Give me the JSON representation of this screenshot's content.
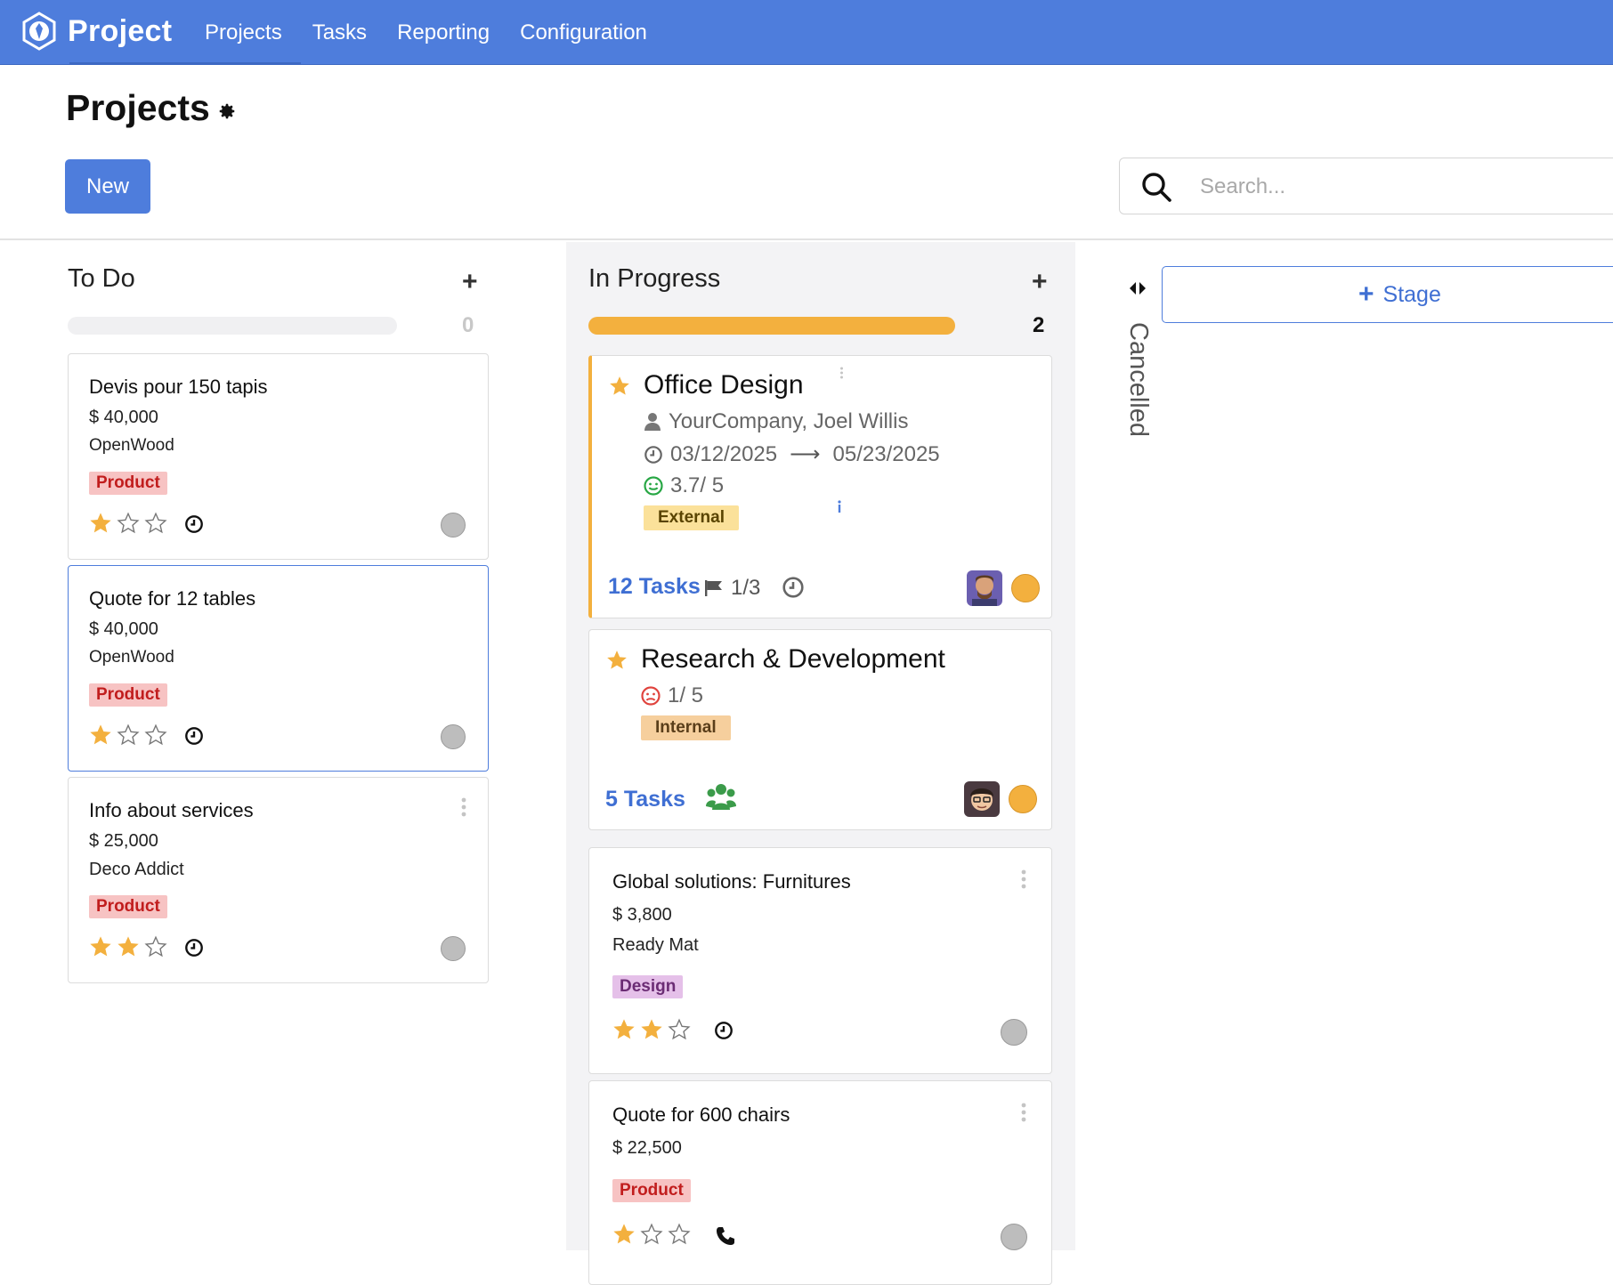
{
  "app": {
    "name": "Project",
    "nav": [
      "Projects",
      "Tasks",
      "Reporting",
      "Configuration"
    ]
  },
  "control_panel": {
    "title": "Projects",
    "new_button": "New",
    "search_placeholder": "Search..."
  },
  "columns": {
    "todo": {
      "title": "To Do",
      "count": "0",
      "progress": 0
    },
    "in_progress": {
      "title": "In Progress",
      "count": "2",
      "progress": 1.0
    },
    "cancelled": {
      "title": "Cancelled",
      "folded": true
    }
  },
  "add_stage": "Stage",
  "todo_cards": [
    {
      "title": "Devis pour 150 tapis",
      "amount": "$ 40,000",
      "partner": "OpenWood",
      "tag": "Product",
      "stars": 1
    },
    {
      "title": "Quote for 12 tables",
      "amount": "$ 40,000",
      "partner": "OpenWood",
      "tag": "Product",
      "stars": 1
    },
    {
      "title": "Info about services",
      "amount": "$ 25,000",
      "partner": "Deco Addict",
      "tag": "Product",
      "stars": 2
    }
  ],
  "projects": [
    {
      "title": "Office Design",
      "customer": "YourCompany, Joel Willis",
      "date_start": "03/12/2025",
      "date_end": "05/23/2025",
      "rating": "3.7/ 5",
      "tag": "External",
      "tasks": "12 Tasks",
      "milestones": "1/3"
    },
    {
      "title": "Research & Development",
      "rating": "1/ 5",
      "tag": "Internal",
      "tasks": "5 Tasks"
    }
  ],
  "progress_cards": [
    {
      "title": "Global solutions: Furnitures",
      "amount": "$ 3,800",
      "partner": "Ready Mat",
      "tag": "Design",
      "stars": 2
    },
    {
      "title": "Quote for 600 chairs",
      "amount": "$ 22,500",
      "tag": "Product",
      "stars": 1
    }
  ],
  "colors": {
    "brand": "#4e7ddc",
    "star": "#f3b03e",
    "progress": "#f3b03e"
  }
}
